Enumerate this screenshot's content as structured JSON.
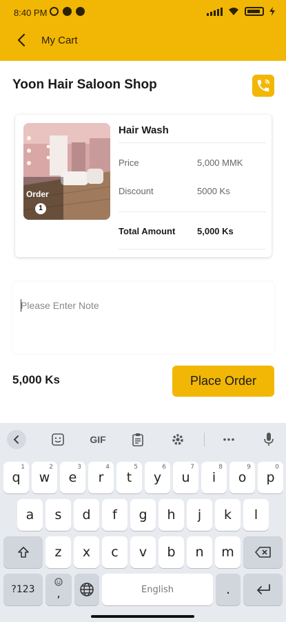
{
  "status_bar": {
    "time": "8:40 PM"
  },
  "app_bar": {
    "title": "My Cart"
  },
  "shop": {
    "name": "Yoon Hair Saloon Shop"
  },
  "order_item": {
    "service_name": "Hair Wash",
    "image_overlay_label": "Order",
    "order_count": "1",
    "rows": [
      {
        "label": "Price",
        "value": "5,000 MMK"
      },
      {
        "label": "Discount",
        "value": "5000 Ks"
      }
    ],
    "total_label": "Total Amount",
    "total_value": "5,000 Ks"
  },
  "note": {
    "placeholder": "Please Enter Note",
    "value": ""
  },
  "footer": {
    "total": "5,000 Ks",
    "place_order_label": "Place Order"
  },
  "keyboard": {
    "toolbar": {
      "gif_label": "GIF"
    },
    "row1": [
      {
        "key": "q",
        "hint": "1"
      },
      {
        "key": "w",
        "hint": "2"
      },
      {
        "key": "e",
        "hint": "3"
      },
      {
        "key": "r",
        "hint": "4"
      },
      {
        "key": "t",
        "hint": "5"
      },
      {
        "key": "y",
        "hint": "6"
      },
      {
        "key": "u",
        "hint": "7"
      },
      {
        "key": "i",
        "hint": "8"
      },
      {
        "key": "o",
        "hint": "9"
      },
      {
        "key": "p",
        "hint": "0"
      }
    ],
    "row2": [
      "a",
      "s",
      "d",
      "f",
      "g",
      "h",
      "j",
      "k",
      "l"
    ],
    "row3": [
      "z",
      "x",
      "c",
      "v",
      "b",
      "n",
      "m"
    ],
    "symbols_label": "?123",
    "comma_label": ",",
    "space_label": "English",
    "period_label": "."
  },
  "colors": {
    "accent": "#f2b705",
    "keyboard_bg": "#e7eaef"
  },
  "icons": [
    "back-arrow-icon",
    "phone-icon",
    "emoji-icon",
    "clipboard-icon",
    "gear-icon",
    "more-icon",
    "mic-icon",
    "shift-icon",
    "backspace-icon",
    "globe-icon",
    "enter-icon"
  ]
}
